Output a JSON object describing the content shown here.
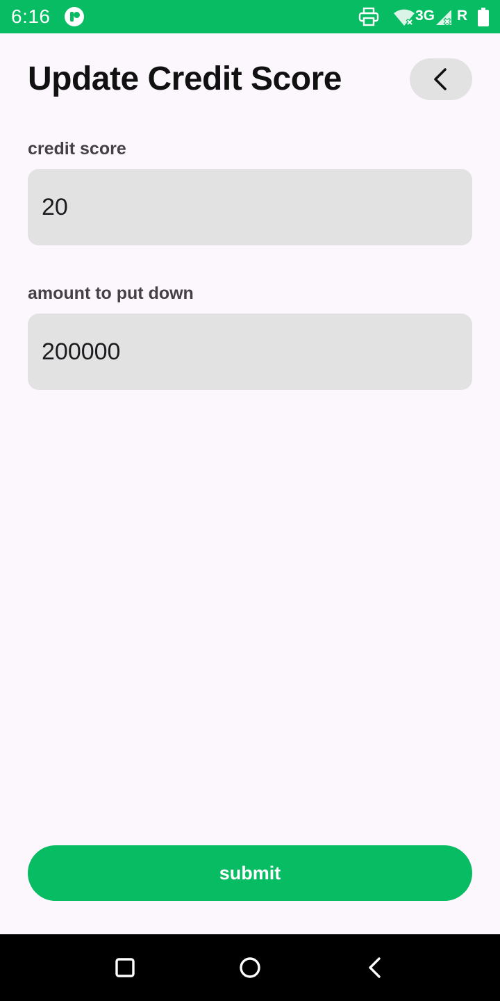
{
  "status_bar": {
    "time": "6:16",
    "network": "3G",
    "roaming": "R",
    "icons": [
      "app-notification-icon",
      "printer-icon",
      "wifi-icon",
      "signal-icon",
      "battery-icon"
    ],
    "background": "#07bc62"
  },
  "header": {
    "title": "Update Credit Score",
    "back_icon": "chevron-left-icon"
  },
  "form": {
    "credit_score": {
      "label": "credit score",
      "value": "20"
    },
    "down_payment": {
      "label": "amount to put down",
      "value": "200000"
    },
    "submit_label": "submit"
  },
  "nav_bar": {
    "icons": [
      "recents-icon",
      "home-icon",
      "back-icon"
    ]
  },
  "colors": {
    "accent": "#07bc62",
    "background": "#fcf6fd",
    "input_background": "#e2e2e2"
  }
}
